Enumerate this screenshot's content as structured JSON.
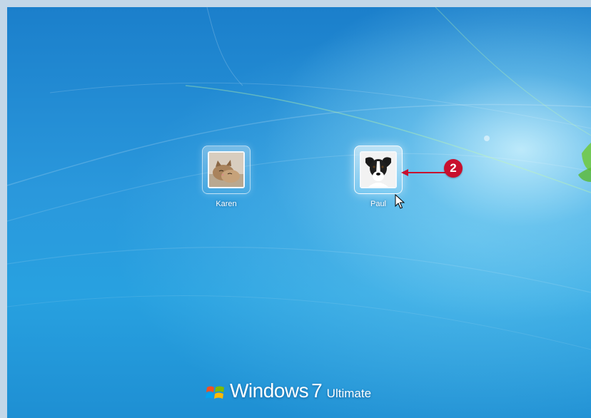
{
  "screen": {
    "type": "Windows 7 logon screen"
  },
  "users": [
    {
      "name": "Karen",
      "picture_icon": "kitten-icon"
    },
    {
      "name": "Paul",
      "picture_icon": "dog-icon"
    }
  ],
  "callout": {
    "number": "2",
    "color": "#c8102e"
  },
  "branding": {
    "windows": "Windows",
    "version": "7",
    "edition": "Ultimate"
  },
  "colors": {
    "background": "#2a98dc",
    "frame": "#c3d7e8",
    "accent": "#c8102e"
  }
}
